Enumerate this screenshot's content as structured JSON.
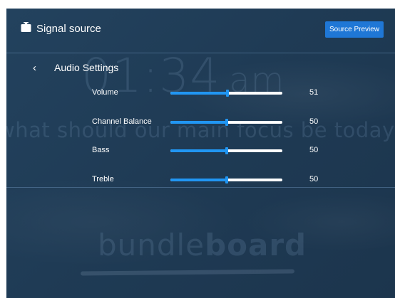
{
  "background": {
    "clock": "01:34",
    "clock_ampm": "am",
    "question": "what should our main focus be today?",
    "logo_light": "bundle",
    "logo_bold": "board"
  },
  "header": {
    "title": "Signal source",
    "icon": "signal-source-icon",
    "preview_button": "Source Preview"
  },
  "panel": {
    "back_icon": "chevron-left",
    "title": "Audio Settings"
  },
  "settings": [
    {
      "label": "Volume",
      "value": "51",
      "level": 0.51
    },
    {
      "label": "Channel Balance",
      "value": "50",
      "level": 0.5
    },
    {
      "label": "Bass",
      "value": "50",
      "level": 0.5
    },
    {
      "label": "Treble",
      "value": "50",
      "level": 0.5
    }
  ],
  "colors": {
    "background": "#1f3b55",
    "accent": "#2196f3",
    "button": "#1f77d6",
    "text": "#ffffff"
  }
}
